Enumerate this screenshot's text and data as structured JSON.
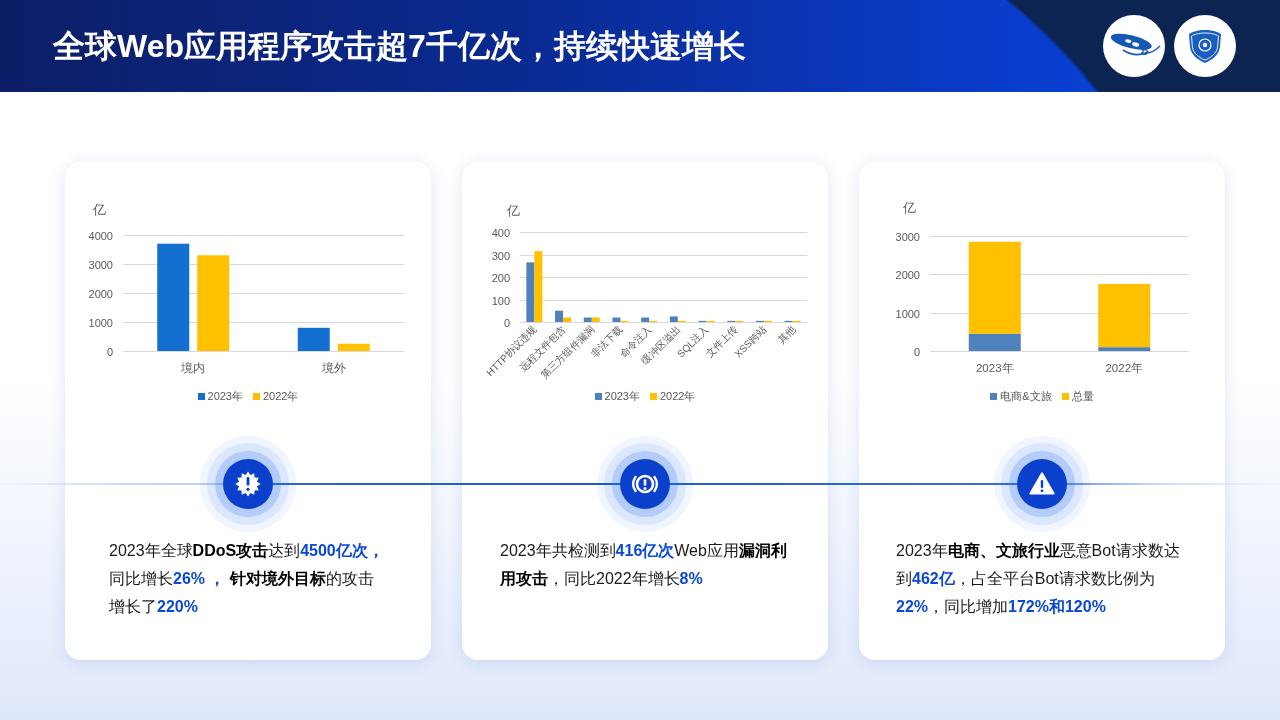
{
  "header": {
    "title": "全球Web应用程序攻击超7千亿次，持续快速增长"
  },
  "cards": [
    {
      "chart_data": {
        "type": "bar",
        "ylabel": "亿",
        "categories": [
          "境内",
          "境外"
        ],
        "series": [
          {
            "name": "2023年",
            "color": "#1470d0",
            "values": [
              3700,
              800
            ]
          },
          {
            "name": "2022年",
            "color": "#ffc000",
            "values": [
              3300,
              250
            ]
          }
        ],
        "ylim": [
          0,
          4000
        ],
        "yticks": [
          0,
          1000,
          2000,
          3000,
          4000
        ],
        "grid": true,
        "legend": true
      },
      "text_runs": [
        {
          "kind": "plain",
          "text": "2023年全球"
        },
        {
          "kind": "bold",
          "text": "DDoS攻击"
        },
        {
          "kind": "plain",
          "text": "达到"
        },
        {
          "kind": "figure",
          "text": "4500亿次，"
        },
        {
          "kind": "plain",
          "text": "同比增长"
        },
        {
          "kind": "figure",
          "text": "26% ，"
        },
        {
          "kind": "bold",
          "text": " 针对境外目标"
        },
        {
          "kind": "plain",
          "text": "的攻击增长了"
        },
        {
          "kind": "figure",
          "text": "220%"
        }
      ]
    },
    {
      "chart_data": {
        "type": "bar",
        "ylabel": "亿",
        "categories": [
          "HTTP协议违规",
          "远程文件包含",
          "第三方组件漏洞",
          "非法下载",
          "命令注入",
          "缓冲区溢出",
          "SQL注入",
          "文件上传",
          "XSS跨站",
          "其他"
        ],
        "series": [
          {
            "name": "2023年",
            "color": "#4f81bd",
            "values": [
              265,
              50,
              20,
              20,
              20,
              25,
              5,
              5,
              5,
              5
            ]
          },
          {
            "name": "2022年",
            "color": "#ffc000",
            "values": [
              315,
              20,
              20,
              5,
              5,
              5,
              5,
              5,
              5,
              5
            ]
          }
        ],
        "ylim": [
          0,
          400
        ],
        "yticks": [
          0,
          100,
          200,
          300,
          400
        ],
        "grid": true,
        "legend": true
      },
      "text_runs": [
        {
          "kind": "plain",
          "text": "2023年共检测到"
        },
        {
          "kind": "figure",
          "text": "416亿次"
        },
        {
          "kind": "plain",
          "text": "Web应用"
        },
        {
          "kind": "bold",
          "text": "漏洞利用攻击"
        },
        {
          "kind": "plain",
          "text": "，同比2022年增长"
        },
        {
          "kind": "figure",
          "text": "8%"
        }
      ]
    },
    {
      "chart_data": {
        "type": "bar",
        "ylabel": "亿",
        "categories": [
          "2023年",
          "2022年"
        ],
        "stacked": true,
        "series": [
          {
            "name": "电商&文旅",
            "color": "#4f81bd",
            "values": [
              450,
              100
            ]
          },
          {
            "name": "总量",
            "color": "#ffc000",
            "values": [
              2400,
              1650
            ]
          }
        ],
        "ylim": [
          0,
          3000
        ],
        "yticks": [
          0,
          1000,
          2000,
          3000
        ],
        "grid": true,
        "legend": true
      },
      "text_runs": [
        {
          "kind": "plain",
          "text": "2023年"
        },
        {
          "kind": "bold",
          "text": "电商、文旅行业"
        },
        {
          "kind": "plain",
          "text": "恶意Bot请求数达到"
        },
        {
          "kind": "figure",
          "text": "462亿"
        },
        {
          "kind": "plain",
          "text": "，占全平台Bot请求数比例为"
        },
        {
          "kind": "figure",
          "text": "22%"
        },
        {
          "kind": "plain",
          "text": "，同比增加"
        },
        {
          "kind": "figure",
          "text": "172%和120%"
        }
      ]
    }
  ]
}
